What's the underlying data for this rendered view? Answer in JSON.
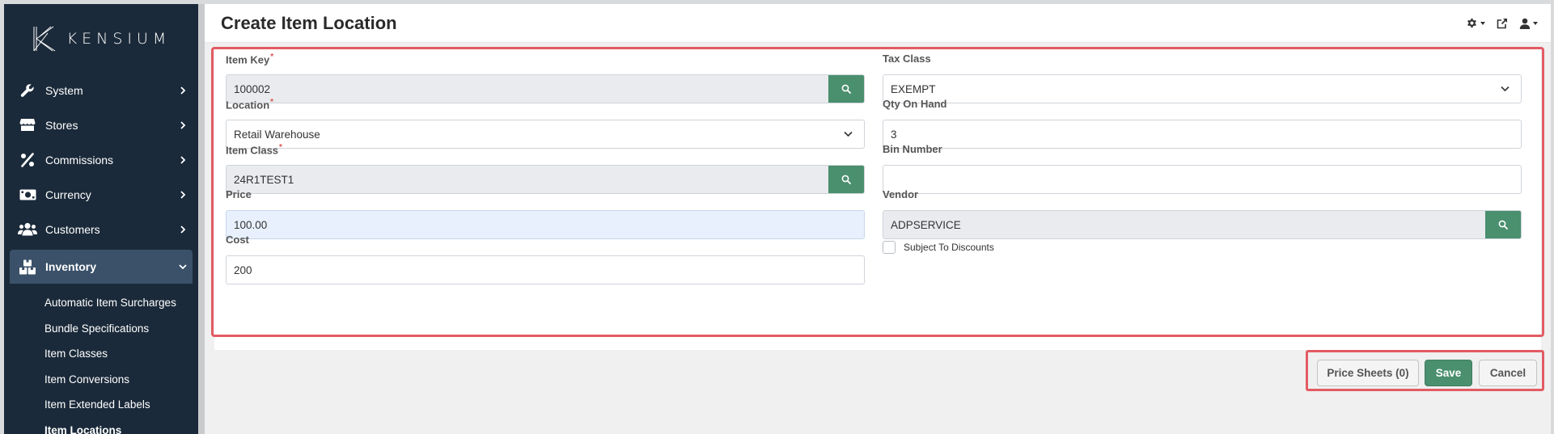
{
  "brand": {
    "name": "KENSIUM"
  },
  "sidebar": {
    "items": [
      {
        "label": "System",
        "icon": "wrench-icon"
      },
      {
        "label": "Stores",
        "icon": "store-icon"
      },
      {
        "label": "Commissions",
        "icon": "percent-icon"
      },
      {
        "label": "Currency",
        "icon": "money-bill-icon"
      },
      {
        "label": "Customers",
        "icon": "users-icon"
      }
    ],
    "active": {
      "label": "Inventory",
      "icon": "boxes-icon"
    },
    "sub_items": [
      "Automatic Item Surcharges",
      "Bundle Specifications",
      "Item Classes",
      "Item Conversions",
      "Item Extended Labels",
      "Item Locations"
    ]
  },
  "header": {
    "title": "Create Item Location",
    "tools": [
      "gear-icon",
      "external-link-icon",
      "user-icon"
    ]
  },
  "form": {
    "item_key": {
      "label": "Item Key",
      "value": "100002"
    },
    "location": {
      "label": "Location",
      "value": "Retail Warehouse"
    },
    "item_class": {
      "label": "Item Class",
      "value": "24R1TEST1"
    },
    "price": {
      "label": "Price",
      "value": "100.00"
    },
    "cost": {
      "label": "Cost",
      "value": "200"
    },
    "tax_class": {
      "label": "Tax Class",
      "value": "EXEMPT"
    },
    "qty_on_hand": {
      "label": "Qty On Hand",
      "value": "3"
    },
    "bin_number": {
      "label": "Bin Number",
      "value": ""
    },
    "vendor": {
      "label": "Vendor",
      "value": "ADPSERVICE"
    },
    "subject_to_discounts": {
      "label": "Subject To Discounts",
      "checked": false
    }
  },
  "actions": {
    "price_sheets": "Price Sheets (0)",
    "save": "Save",
    "cancel": "Cancel"
  },
  "colors": {
    "sidebar_bg": "#1b2a3a",
    "sidebar_active": "#3a5169",
    "primary_green": "#4a8f6e",
    "highlight_red": "#e35b63"
  }
}
